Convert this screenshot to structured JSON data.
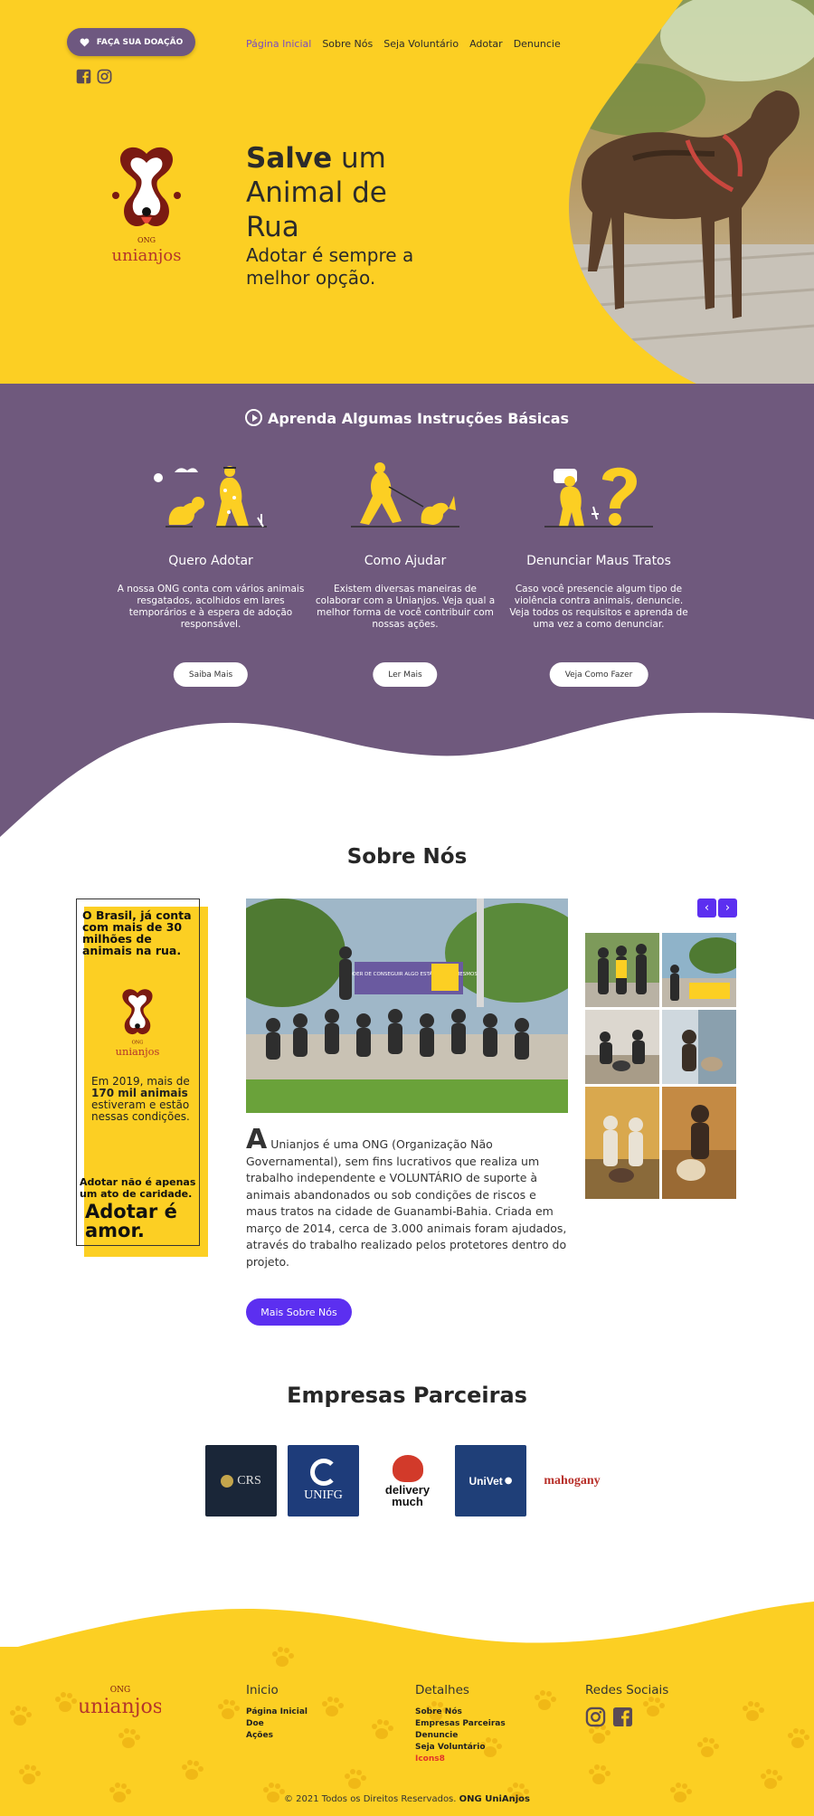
{
  "header": {
    "donate_label": "FAÇA SUA DOAÇÃO",
    "nav": [
      "Página Inicial",
      "Sobre Nós",
      "Seja Voluntário",
      "Adotar",
      "Denuncie"
    ],
    "active_nav_color": "#7a4cc2"
  },
  "hero": {
    "title_bold": "Salve",
    "title_rest": " um Animal de Rua",
    "subtitle": "Adotar é sempre a melhor opção.",
    "logo_small": "ONG",
    "logo_name": "unianjos"
  },
  "instructions": {
    "title": "Aprenda Algumas Instruções Básicas",
    "cards": [
      {
        "title": "Quero Adotar",
        "text": "A nossa ONG conta com vários animais resgatados, acolhidos em lares temporários e à espera de adoção responsável.",
        "button": "Saiba Mais"
      },
      {
        "title": "Como Ajudar",
        "text": "Existem diversas maneiras de colaborar com a Unianjos. Veja qual a melhor forma de você contribuir com nossas ações.",
        "button": "Ler Mais"
      },
      {
        "title": "Denunciar Maus Tratos",
        "text": "Caso você presencie algum tipo de violência contra animais, denuncie. Veja todos os requisitos e aprenda de uma vez a como denunciar.",
        "button": "Veja Como Fazer"
      }
    ]
  },
  "about": {
    "title": "Sobre Nós",
    "poster": {
      "line1": "O Brasil, já conta com mais de 30 milhões de animais na rua.",
      "line2_pre": "Em 2019, mais de ",
      "line2_bold": "170 mil animais",
      "line2_post": " estiveram e estão nessas condições.",
      "line3": "Adotar não é apenas um ato de caridade.",
      "line4": "Adotar é amor.",
      "logo_small": "ONG",
      "logo_name": "unianjos"
    },
    "banner_text": "O PODER DE CONSEGUIR ALGO ESTÁ EM NÓS MESMOS",
    "text_cap": "A",
    "text": " Unianjos é uma ONG (Organização Não Governamental), sem fins lucrativos que realiza um trabalho independente e VOLUNTÁRIO de suporte à animais abandonados ou sob condições de riscos e maus tratos na cidade de Guanambi-Bahia. Criada em março de 2014, cerca de 3.000 animais foram ajudados, através do trabalho realizado pelos protetores dentro do projeto.",
    "button": "Mais Sobre Nós",
    "gallery_prev": "‹",
    "gallery_next": "›"
  },
  "partners": {
    "title": "Empresas Parceiras",
    "items": [
      "CRS",
      "UNIFG",
      "delivery much",
      "UniVet",
      "mahogany"
    ]
  },
  "footer": {
    "logo_small": "ONG",
    "logo_name": "unianjos",
    "col1_title": "Inicio",
    "col1_items": [
      "Página Inicial",
      "Doe",
      "Ações"
    ],
    "col2_title": "Detalhes",
    "col2_items": [
      "Sobre Nós",
      "Empresas Parceiras",
      "Denuncie",
      "Seja Voluntário",
      "Icons8"
    ],
    "col3_title": "Redes Sociais",
    "copyright_pre": "© 2021 Todos os Direitos Reservados.",
    "copyright_brand": "ONG UniAnjos"
  },
  "colors": {
    "yellow": "#fccf23",
    "purple": "#6f597d",
    "accent": "#5c2ff0",
    "icons8_red": "#e2342a"
  }
}
